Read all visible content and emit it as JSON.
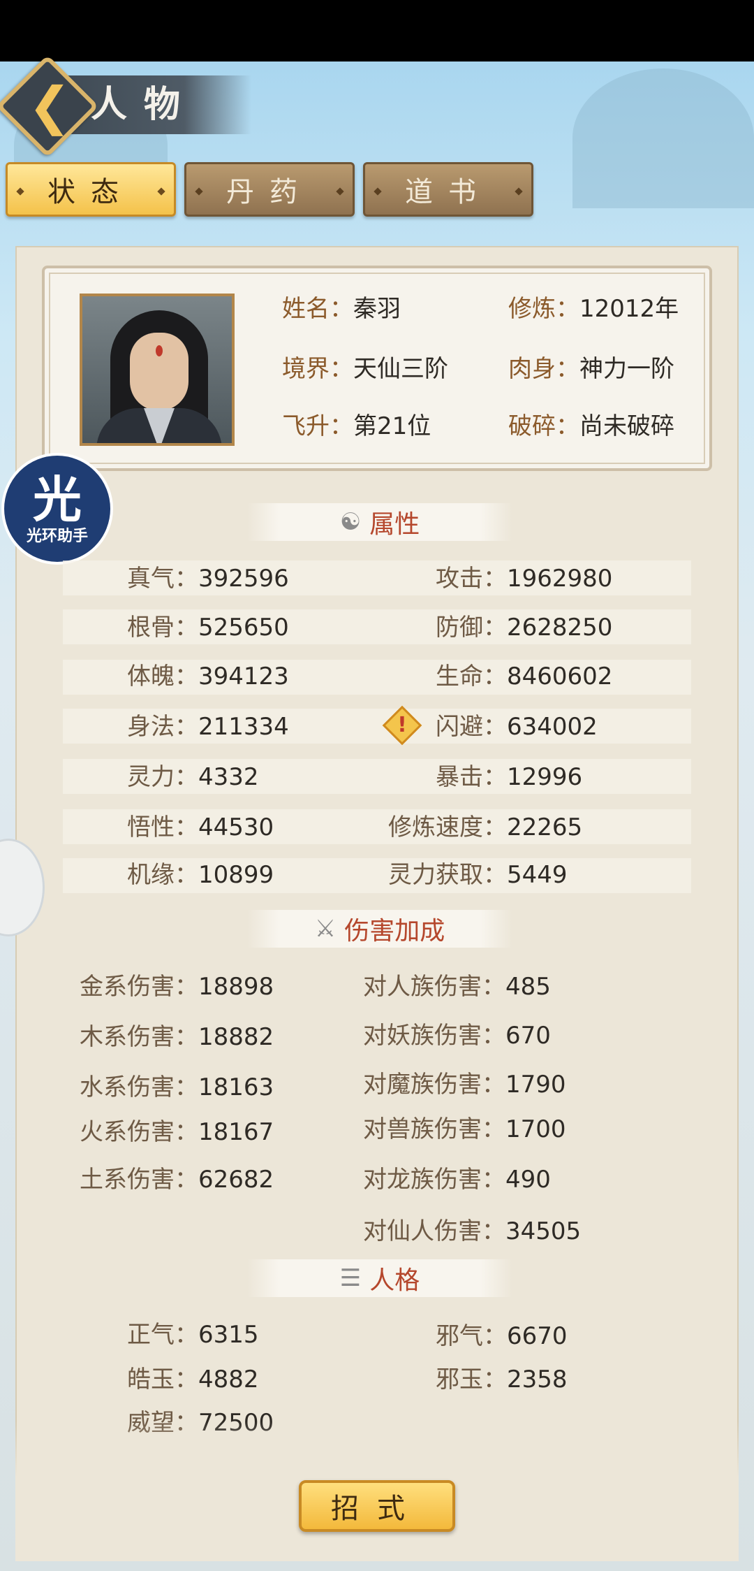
{
  "header": {
    "title": "人物"
  },
  "tabs": [
    {
      "label": "状态",
      "active": true
    },
    {
      "label": "丹药",
      "active": false
    },
    {
      "label": "道书",
      "active": false
    }
  ],
  "profile": {
    "name_label": "姓名：",
    "name": "秦羽",
    "cultivation_label": "修炼：",
    "cultivation": "12012年",
    "realm_label": "境界：",
    "realm": "天仙三阶",
    "body_label": "肉身：",
    "body": "神力一阶",
    "ascension_label": "飞升：",
    "ascension": "第21位",
    "shatter_label": "破碎：",
    "shatter": "尚未破碎"
  },
  "badge": {
    "big": "光",
    "small": "光环助手"
  },
  "sections": {
    "attributes": {
      "title": "属性",
      "icon": "yin-yang-icon"
    },
    "damage": {
      "title": "伤害加成",
      "icon": "crossed-swords-icon"
    },
    "personality": {
      "title": "人格",
      "icon": "book-icon"
    }
  },
  "attributes": {
    "zhenqi_k": "真气：",
    "zhenqi": "392596",
    "gongji_k": "攻击：",
    "gongji": "1962980",
    "gengu_k": "根骨：",
    "gengu": "525650",
    "fangyu_k": "防御：",
    "fangyu": "2628250",
    "tipo_k": "体魄：",
    "tipo": "394123",
    "shengming_k": "生命：",
    "shengming": "8460602",
    "shenfa_k": "身法：",
    "shenfa": "211334",
    "shanbi_k": "闪避：",
    "shanbi": "634002",
    "lingli_k": "灵力：",
    "lingli": "4332",
    "baoji_k": "暴击：",
    "baoji": "12996",
    "wuxing_k": "悟性：",
    "wuxing": "44530",
    "xiulian_sudu_k": "修炼速度：",
    "xiulian_sudu": "22265",
    "jiyuan_k": "机缘：",
    "jiyuan": "10899",
    "lingli_huoqu_k": "灵力获取：",
    "lingli_huoqu": "5449"
  },
  "damage": {
    "jin_k": "金系伤害：",
    "jin": "18898",
    "mu_k": "木系伤害：",
    "mu": "18882",
    "shui_k": "水系伤害：",
    "shui": "18163",
    "huo_k": "火系伤害：",
    "huo": "18167",
    "tu_k": "土系伤害：",
    "tu": "62682",
    "renzu_k": "对人族伤害：",
    "renzu": "485",
    "yaozu_k": "对妖族伤害：",
    "yaozu": "670",
    "mozu_k": "对魔族伤害：",
    "mozu": "1790",
    "shouzu_k": "对兽族伤害：",
    "shouzu": "1700",
    "longzu_k": "对龙族伤害：",
    "longzu": "490",
    "xianren_k": "对仙人伤害：",
    "xianren": "34505"
  },
  "personality": {
    "zhengqi_k": "正气：",
    "zhengqi": "6315",
    "xieqi_k": "邪气：",
    "xieqi": "6670",
    "haoyu_k": "皓玉：",
    "haoyu": "4882",
    "xieyu_k": "邪玉：",
    "xieyu": "2358",
    "weiwang_k": "威望：",
    "weiwang": "72500"
  },
  "bottom_button": {
    "label": "招式"
  },
  "colors": {
    "accent_gold": "#f4c24a",
    "title_red": "#b5472c",
    "label_brown": "#8b5a2b"
  }
}
